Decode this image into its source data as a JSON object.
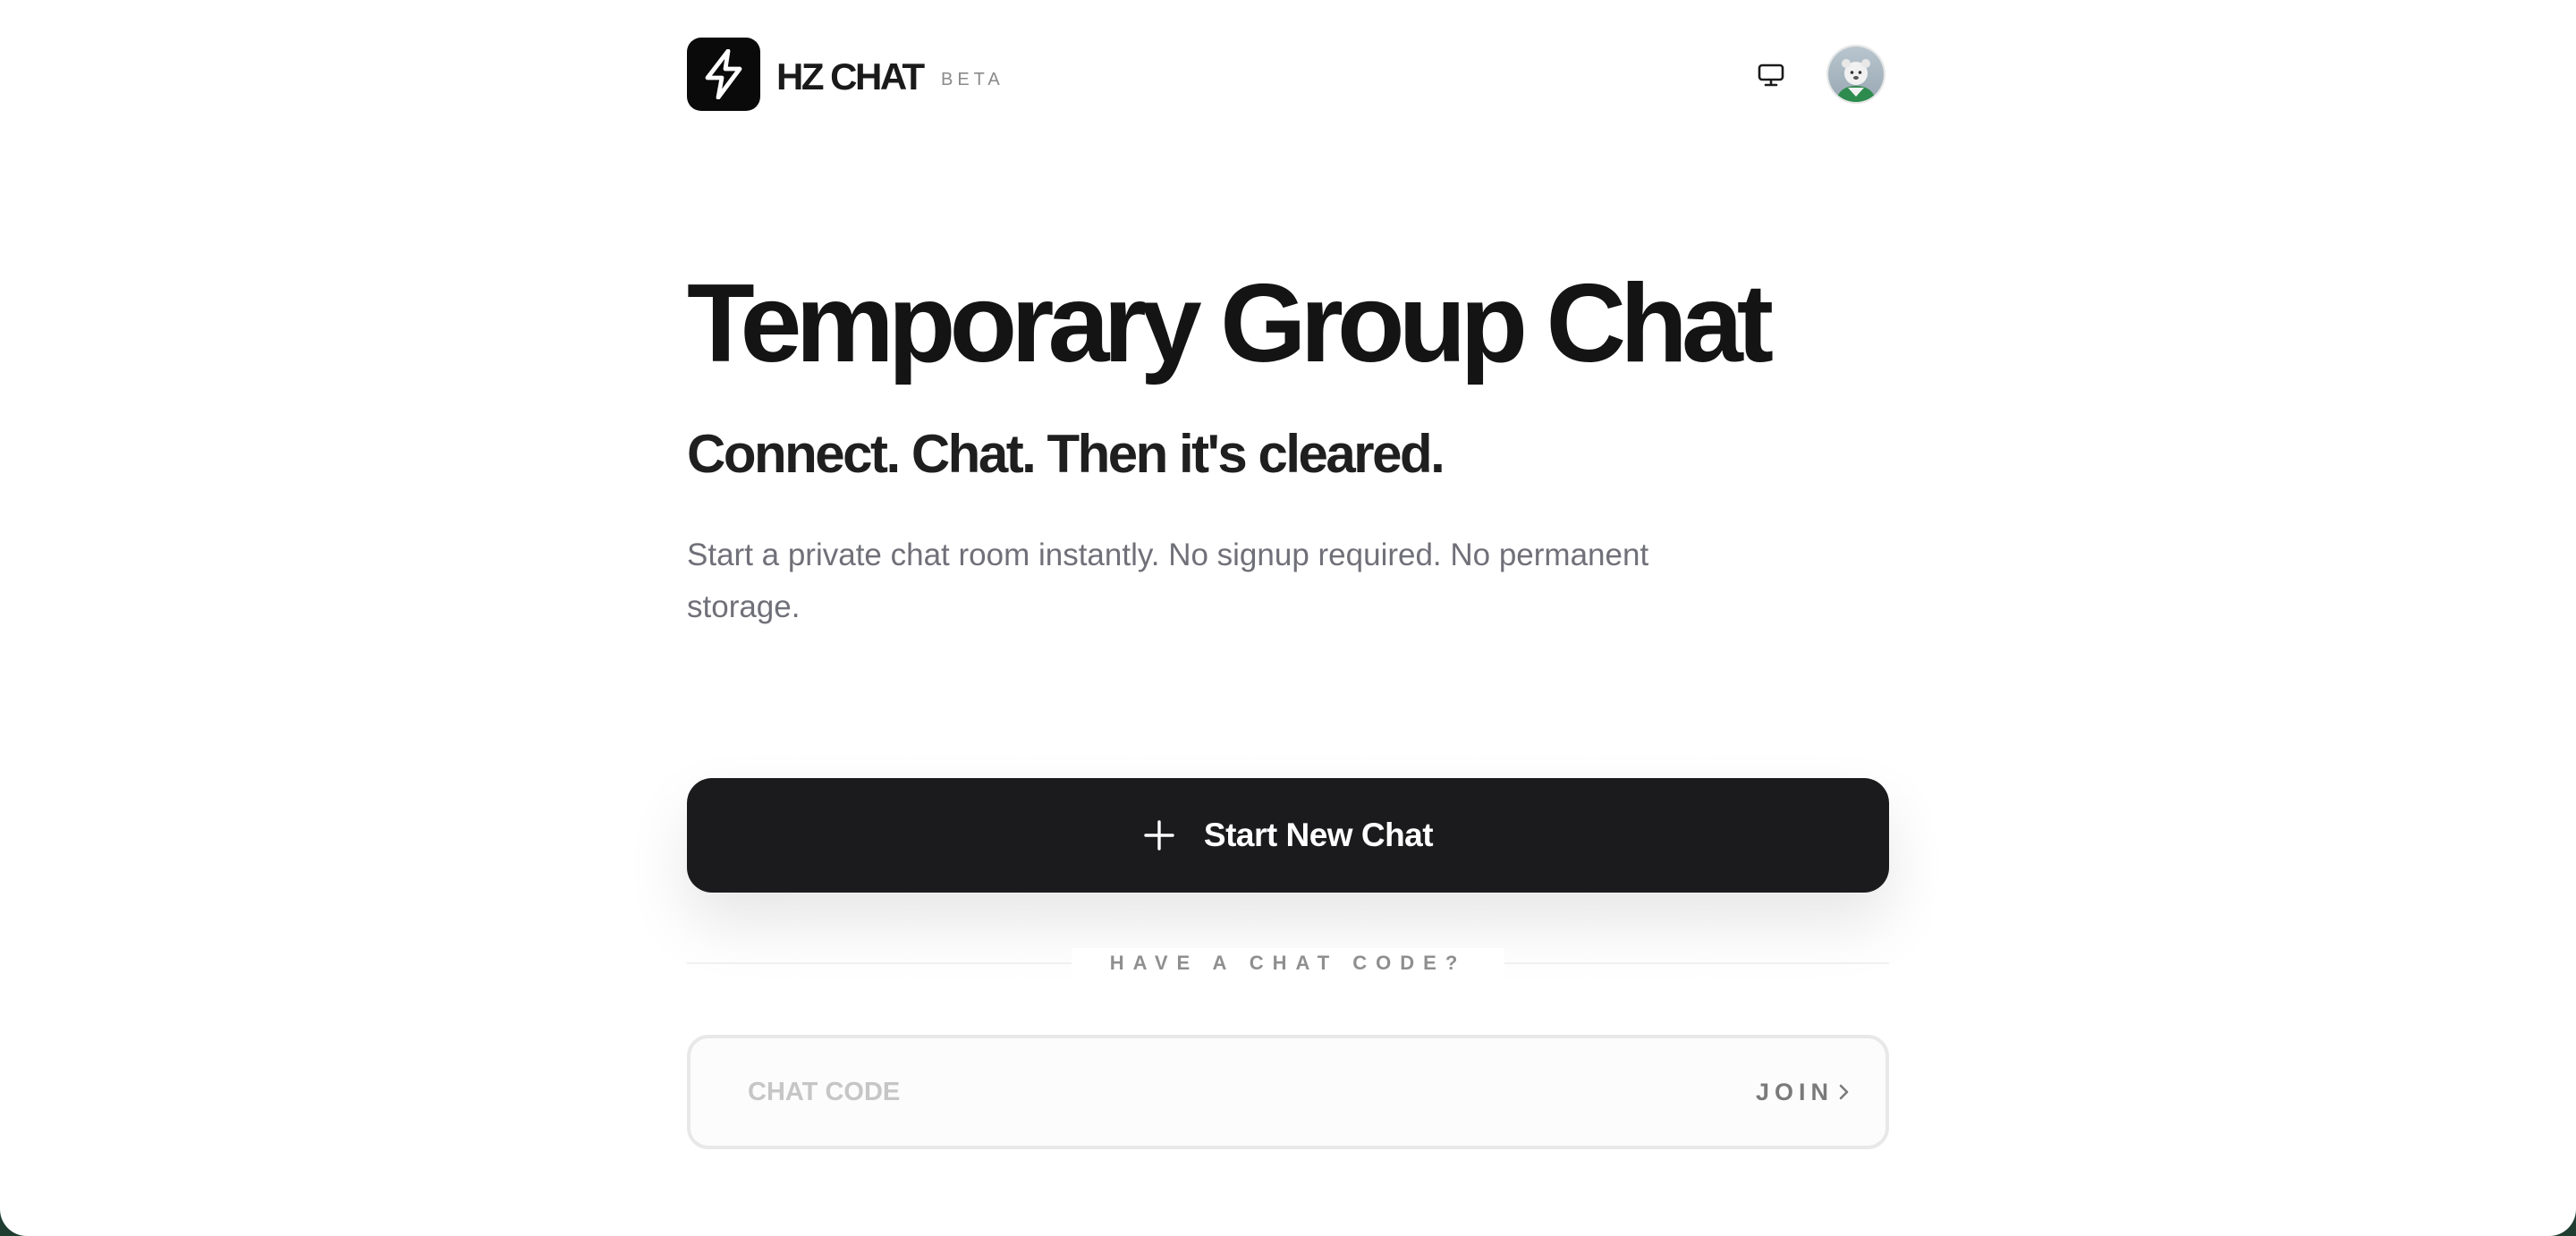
{
  "header": {
    "brand": "HZ CHAT",
    "badge": "BETA",
    "logo_icon": "lightning-bolt-icon",
    "display_icon": "monitor-icon",
    "avatar_icon": "user-avatar"
  },
  "hero": {
    "title": "Temporary Group Chat",
    "subtitle": "Connect. Chat. Then it's cleared.",
    "description": "Start a private chat room instantly. No signup required. No permanent storage."
  },
  "actions": {
    "start_label": "Start New Chat",
    "start_icon": "plus-icon",
    "divider_label": "HAVE A CHAT CODE?",
    "code_placeholder": "CHAT CODE",
    "code_value": "",
    "join_label": "JOIN",
    "join_icon": "chevron-right-icon"
  },
  "colors": {
    "background": "#ffffff",
    "primary_button": "#1b1b1d",
    "text_primary": "#141414",
    "text_muted": "#707079",
    "outer_frame": "#1f3d30"
  }
}
